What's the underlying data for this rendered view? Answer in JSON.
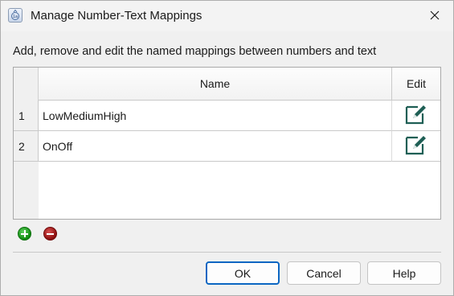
{
  "window": {
    "title": "Manage Number-Text Mappings"
  },
  "description": "Add, remove and edit the named mappings between numbers and text",
  "table": {
    "columns": {
      "name": "Name",
      "edit": "Edit"
    },
    "rows": [
      {
        "index": "1",
        "name": "LowMediumHigh"
      },
      {
        "index": "2",
        "name": "OnOff"
      }
    ]
  },
  "icons": {
    "app": "dialog-app-icon",
    "close": "close-icon",
    "edit": "edit-pencil-icon",
    "add": "add-plus-icon",
    "remove": "remove-minus-icon"
  },
  "colors": {
    "edit_icon": "#1f5f55",
    "add": "#0f8a0f",
    "remove": "#8b0d0d",
    "default_button_border": "#0c66c2"
  },
  "buttons": {
    "ok": "OK",
    "cancel": "Cancel",
    "help": "Help"
  }
}
